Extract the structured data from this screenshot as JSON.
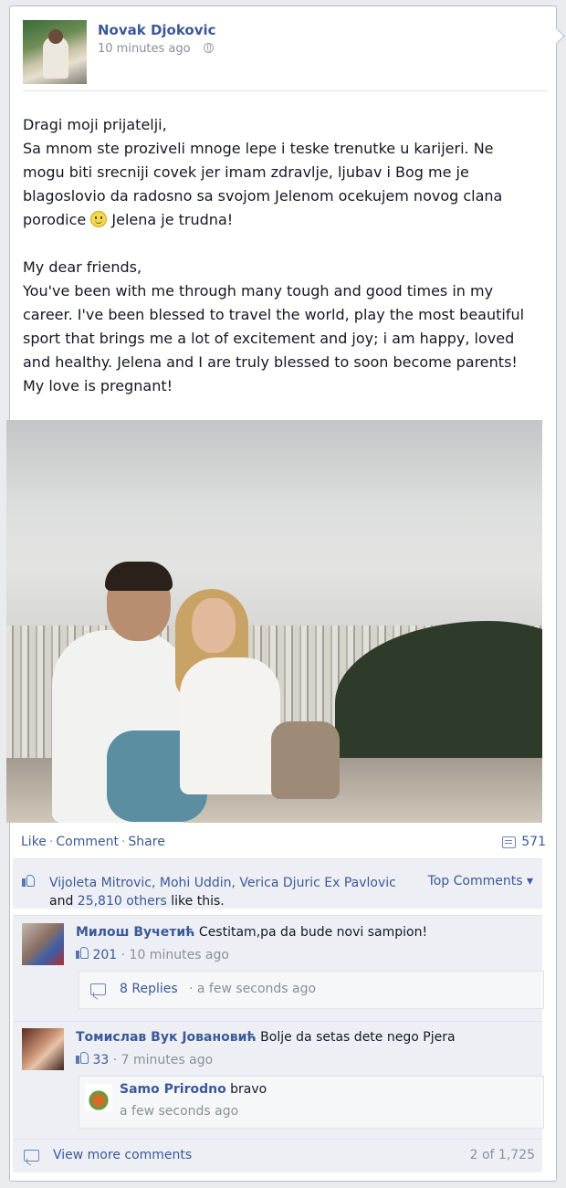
{
  "post": {
    "author": "Novak Djokovic",
    "time": "10 minutes ago",
    "privacy_icon": "globe-icon",
    "paragraph1_lines": [
      "Dragi moji prijatelji,",
      "Sa mnom ste proziveli mnoge lepe i teske trenutke u karijeri. Ne mogu biti srecniji covek jer imam zdravlje, ljubav i Bog me je blagoslovio da radosno sa svojom Jelenom ocekujem novog clana porodice"
    ],
    "paragraph1_tail": "Jelena je trudna!",
    "paragraph2_lines": [
      "My dear friends,",
      "You've been with me through many tough and good times in my career. I've been blessed to travel the world, play the most beautiful sport that brings me a lot of excitement and joy; i am happy, loved and healthy. Jelena and I are truly blessed to soon become parents! My love is pregnant!"
    ]
  },
  "actions": {
    "like": "Like",
    "comment": "Comment",
    "share": "Share",
    "comment_count": "571"
  },
  "likes": {
    "names": "Vijoleta Mitrovic, Mohi Uddin, Verica Djuric Ex Pavlovic",
    "and": "and",
    "others": "25,810 others",
    "suffix": "like this.",
    "top_comments": "Top Comments ▾"
  },
  "comments": [
    {
      "name": "Милош Вучетић",
      "text": "Cestitam,pa da bude novi sampion!",
      "likes": "201",
      "time": "10 minutes ago",
      "replies": "8 Replies",
      "reply_time": "a few seconds ago"
    },
    {
      "name": "Томислав Вук Јовановић",
      "text": "Bolje da setas dete nego Pjera",
      "likes": "33",
      "time": "7 minutes ago",
      "reply_name": "Samo Prirodno",
      "reply_text": "bravo",
      "reply_time": "a few seconds ago"
    }
  ],
  "footer": {
    "view_more": "View more comments",
    "pagination": "2 of 1,725"
  },
  "colors": {
    "link": "#3b5998",
    "muted": "#8a8f99",
    "panel": "#edeff4"
  }
}
